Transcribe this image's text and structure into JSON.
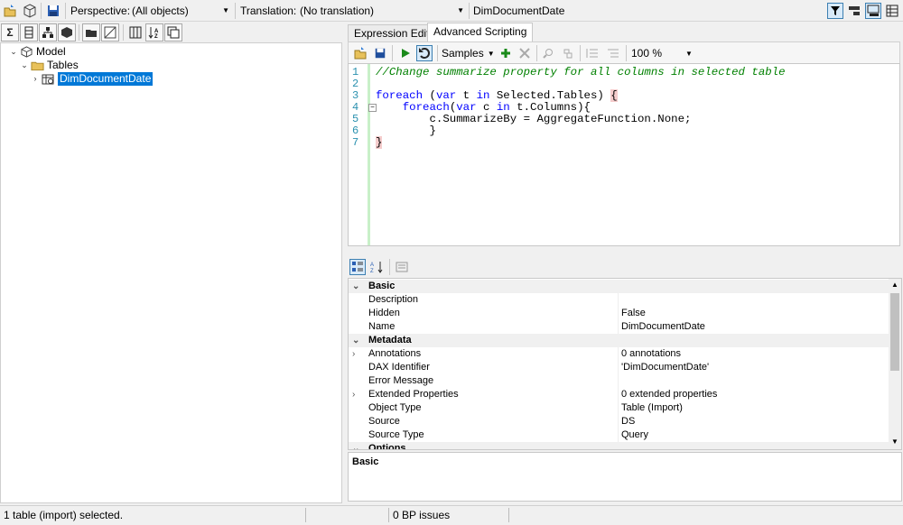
{
  "toolbar": {
    "perspective_label": "Perspective:",
    "perspective_value": "(All objects)",
    "translation_label": "Translation:",
    "translation_value": "(No translation)",
    "selected_object": "DimDocumentDate"
  },
  "tree": {
    "model": "Model",
    "tables": "Tables",
    "table": "DimDocumentDate"
  },
  "tabs": {
    "expression_editor": "Expression Editor",
    "advanced_scripting": "Advanced Scripting"
  },
  "editor_toolbar": {
    "samples": "Samples",
    "zoom": "100 %"
  },
  "code": {
    "line_numbers": [
      "1",
      "2",
      "3",
      "4",
      "5",
      "6",
      "7"
    ],
    "line1": "//Change summarize property for all columns in selected table",
    "l3_kw1": "foreach",
    "l3_a": " (",
    "l3_kw2": "var",
    "l3_b": " t ",
    "l3_kw3": "in",
    "l3_c": " Selected.Tables) ",
    "l3_brace": "{",
    "l4_indent": "    ",
    "l4_kw1": "foreach",
    "l4_a": "(",
    "l4_kw2": "var",
    "l4_b": " c ",
    "l4_kw3": "in",
    "l4_c": " t.Columns){",
    "line5": "        c.SummarizeBy = AggregateFunction.None;",
    "line6": "        }",
    "line7": "}"
  },
  "properties": {
    "cat_basic": "Basic",
    "description": "Description",
    "hidden": "Hidden",
    "hidden_value": "False",
    "name": "Name",
    "name_value": "DimDocumentDate",
    "cat_metadata": "Metadata",
    "annotations": "Annotations",
    "annotations_value": "0 annotations",
    "dax_identifier": "DAX Identifier",
    "dax_identifier_value": "'DimDocumentDate'",
    "error_message": "Error Message",
    "extended_properties": "Extended Properties",
    "extended_properties_value": "0 extended properties",
    "object_type": "Object Type",
    "object_type_value": "Table (Import)",
    "source": "Source",
    "source_value": "DS",
    "source_type": "Source Type",
    "source_type_value": "Query",
    "cat_options": "Options"
  },
  "description_panel": {
    "title": "Basic"
  },
  "status": {
    "selection": "1 table (import) selected.",
    "bp_issues": "0 BP issues"
  }
}
